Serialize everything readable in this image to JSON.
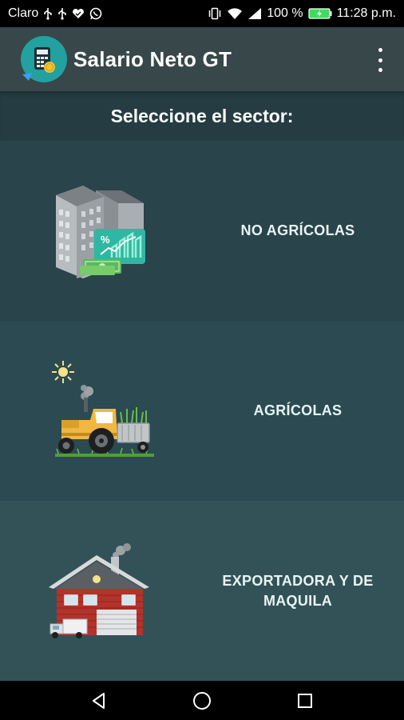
{
  "status_bar": {
    "carrier": "Claro",
    "battery": "100 %",
    "time": "11:28 p.m.",
    "icons": [
      "usb-icon",
      "usb-icon",
      "heart-icon",
      "whatsapp-icon",
      "vibrate-icon",
      "wifi-icon",
      "signal-icon",
      "battery-charging-icon"
    ]
  },
  "app_bar": {
    "title": "Salario Neto GT",
    "logo_icon": "calculator-money-icon",
    "menu_icon": "overflow-menu-icon"
  },
  "subheader": {
    "text": "Seleccione el sector:"
  },
  "sectors": [
    {
      "label": "NO AGRÍCOLAS",
      "icon": "office-buildings-icon"
    },
    {
      "label": "AGRÍCOLAS",
      "icon": "tractor-icon"
    },
    {
      "label": "EXPORTADORA Y DE MAQUILA",
      "icon": "factory-icon"
    }
  ],
  "nav_bar": {
    "icons": [
      "back-icon",
      "home-icon",
      "recents-icon"
    ]
  },
  "colors": {
    "status_bar": "#000000",
    "app_bar": "#37474a",
    "subheader": "#243c42",
    "sector_1": "#29444a",
    "sector_2": "#2b4a52",
    "sector_3": "#335258",
    "accent": "#23a0a0"
  }
}
